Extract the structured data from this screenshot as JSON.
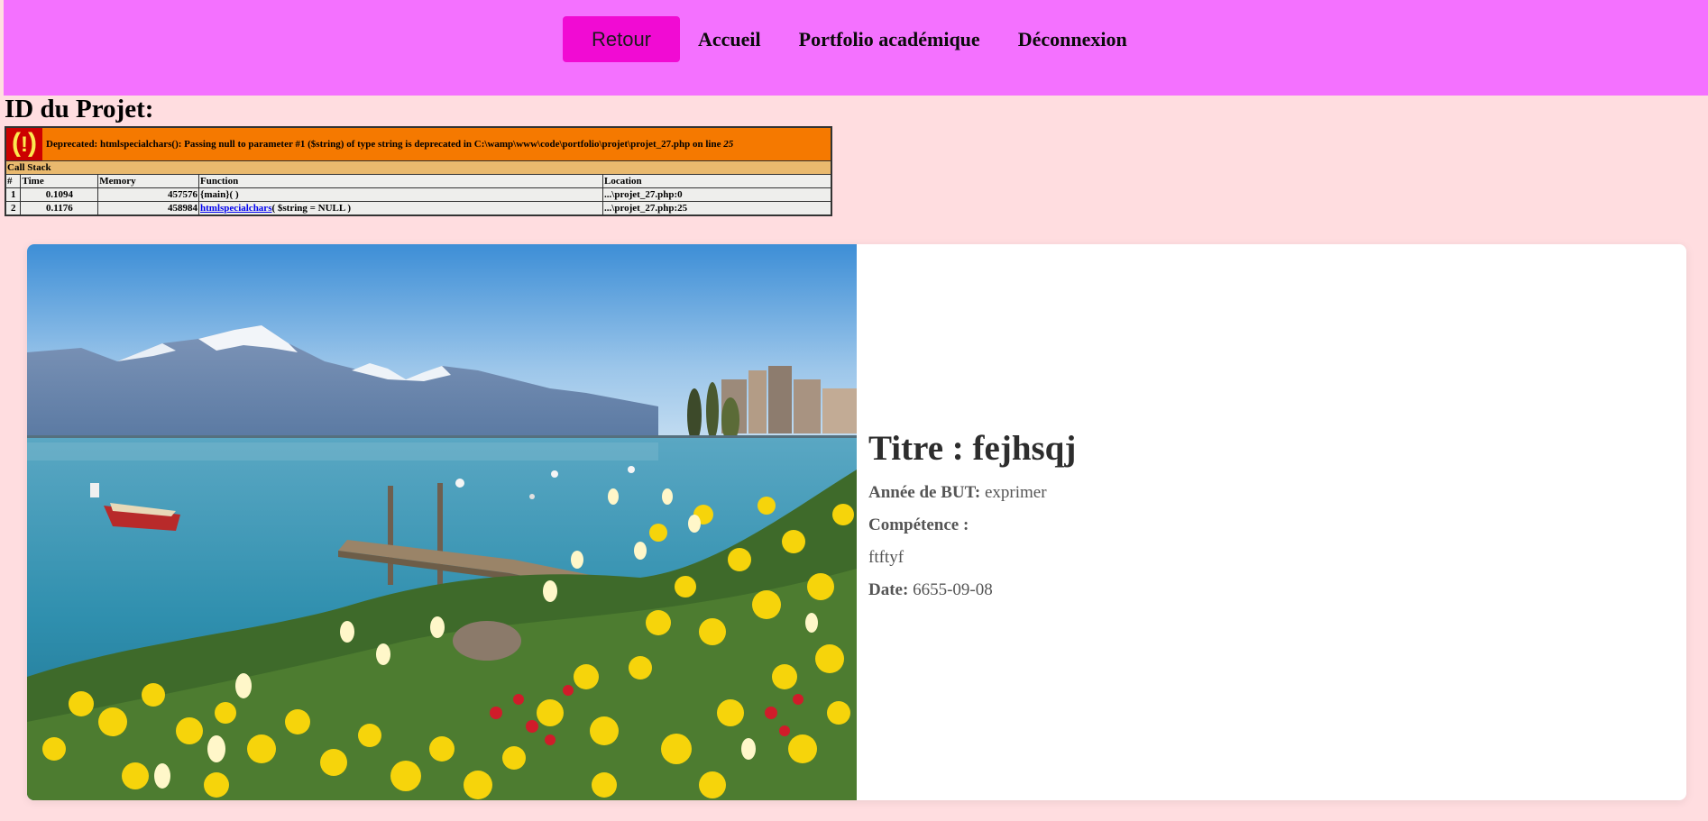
{
  "nav": {
    "back_label": "Retour",
    "links": [
      "Accueil",
      "Portfolio académique",
      "Déconnexion"
    ]
  },
  "page": {
    "title": "ID du Projet:"
  },
  "error": {
    "icon": "(!)",
    "message": "Deprecated: htmlspecialchars(): Passing null to parameter #1 ($string) of type string is deprecated in C:\\wamp\\www\\code\\portfolio\\projet\\projet_27.php on line",
    "line": "25",
    "call_stack_label": "Call Stack",
    "columns": [
      "#",
      "Time",
      "Memory",
      "Function",
      "Location"
    ],
    "rows": [
      {
        "num": "1",
        "time": "0.1094",
        "memory": "457576",
        "function": "{main}( )",
        "function_link": "",
        "function_args": "",
        "location": "...\\projet_27.php:0"
      },
      {
        "num": "2",
        "time": "0.1176",
        "memory": "458984",
        "function": "",
        "function_link": "htmlspecialchars",
        "function_args": "( $string = NULL )",
        "location": "...\\projet_27.php:25"
      }
    ]
  },
  "project": {
    "title": "Titre : fejhsqj",
    "annee_label": "Année de BUT:",
    "annee_value": "exprimer",
    "competence_label": "Compétence :",
    "competence_value": "ftftyf",
    "date_label": "Date:",
    "date_value": "6655-09-08"
  },
  "colors": {
    "navbar": "#f471ff",
    "back_button": "#f10bd3",
    "page_background": "#ffdde0",
    "error_bar": "#f57900",
    "callstack_bar": "#e9b96e"
  },
  "icons": {
    "error": "warning-icon"
  }
}
